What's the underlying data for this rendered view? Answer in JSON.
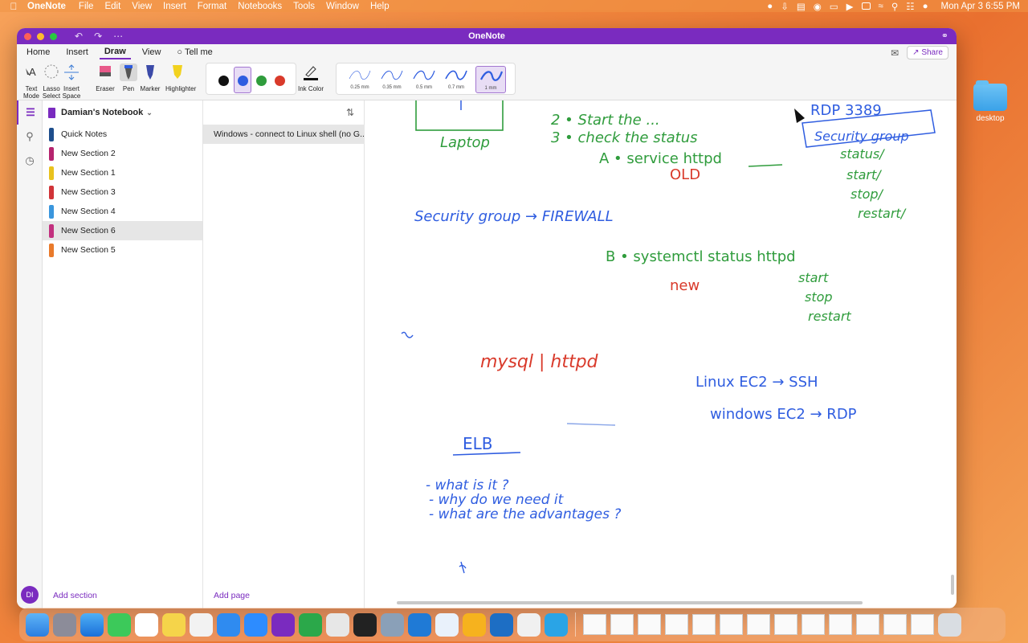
{
  "menubar": {
    "app": "OneNote",
    "items": [
      "File",
      "Edit",
      "View",
      "Insert",
      "Format",
      "Notebooks",
      "Tools",
      "Window",
      "Help"
    ],
    "clock": "Mon Apr 3  6:55 PM"
  },
  "desktop": {
    "folder_label": "desktop"
  },
  "window": {
    "title": "OneNote"
  },
  "ribbon": {
    "tabs": [
      "Home",
      "Insert",
      "Draw",
      "View",
      "Tell me"
    ],
    "active_tab": "Draw",
    "share_label": "Share",
    "tools": {
      "text_mode": "Text Mode",
      "lasso_select": "Lasso Select",
      "insert_space": "Insert Space",
      "eraser": "Eraser",
      "pen": "Pen",
      "marker": "Marker",
      "highlighter": "Highlighter",
      "ink_color": "Ink Color"
    },
    "pen_colors": [
      "#111111",
      "#2f5de0",
      "#2f9c3c",
      "#d93a2b"
    ],
    "selected_pen_color": "#2f5de0",
    "thickness": [
      "0.25 mm",
      "0.35 mm",
      "0.5 mm",
      "0.7 mm",
      "1 mm"
    ],
    "selected_thickness": "1 mm"
  },
  "notebook": {
    "name": "Damian's Notebook",
    "sections": [
      {
        "label": "Quick Notes",
        "color": "#1e4e8c"
      },
      {
        "label": "New Section 2",
        "color": "#b5246e"
      },
      {
        "label": "New Section 1",
        "color": "#e9c21e"
      },
      {
        "label": "New Section 3",
        "color": "#d13438"
      },
      {
        "label": "New Section 4",
        "color": "#3a96dd"
      },
      {
        "label": "New Section 6",
        "color": "#c2307e"
      },
      {
        "label": "New Section 5",
        "color": "#e97a2b"
      }
    ],
    "selected_section": "New Section 6",
    "add_section": "Add section"
  },
  "pages": {
    "items": [
      "Windows - connect to Linux shell (no G..."
    ],
    "add_page": "Add page"
  },
  "user": {
    "initials": "DI"
  },
  "ink_notes": {
    "laptop": "Laptop",
    "step2": "2 • Start the ...",
    "step3": "3 • check the status",
    "rdp": "RDP 3389",
    "security_group_box": "Security group",
    "a_service": "A • service httpd",
    "old": "OLD",
    "status1": "status/",
    "start1": "start/",
    "stop1": "stop/",
    "restart1": "restart/",
    "security_firewall": "Security group → FIREWALL",
    "b_systemctl": "B • systemctl status httpd",
    "new": "new",
    "start2": "start",
    "stop2": "stop",
    "restart2": "restart",
    "mysql_httpd": "mysql | httpd",
    "linux_ec2": "Linux EC2 → SSH",
    "windows_ec2": "windows EC2 → RDP",
    "elb": "ELB",
    "q1": "- what is it ?",
    "q2": "- why do we need it",
    "q3": "- what are the advantages ?"
  },
  "colors": {
    "accent": "#7a2bbf",
    "ink_blue": "#2f5de0",
    "ink_green": "#2f9c3c",
    "ink_red": "#d93a2b"
  }
}
